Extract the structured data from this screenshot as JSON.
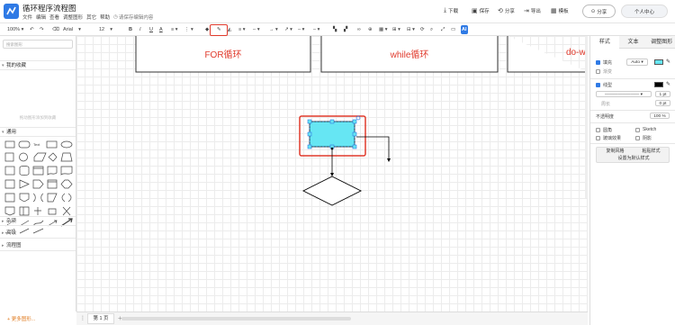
{
  "app": {
    "title": "循环程序流程图",
    "save_hint": "请保存编辑内容"
  },
  "menu": [
    "文件",
    "编辑",
    "查看",
    "调整图形",
    "其它",
    "帮助"
  ],
  "header_actions": [
    {
      "icon": "download-icon",
      "label": "下载"
    },
    {
      "icon": "save-icon",
      "label": "保存"
    },
    {
      "icon": "share-icon",
      "label": "分享"
    },
    {
      "icon": "export-icon",
      "label": "导出"
    },
    {
      "icon": "template-icon",
      "label": "模板"
    }
  ],
  "header_buttons": {
    "share": "分享",
    "user": "个人中心"
  },
  "toolbar": {
    "zoom": "100%",
    "font": "Arial",
    "font_size": "12",
    "bold": "B",
    "italic": "I",
    "underline": "U",
    "font_color": "A",
    "ai": "AI"
  },
  "left_panel": {
    "search_placeholder": "搜索图形",
    "sections": {
      "favorites": "我的收藏",
      "general": "通用",
      "misc": "杂项",
      "advanced": "高级",
      "flowchart": "流程图"
    },
    "favorites_hint": "拖动图形添加到收藏",
    "more_shapes": "+ 更多图形..."
  },
  "canvas": {
    "labels": [
      "FOR循环",
      "while循环",
      "do-w"
    ]
  },
  "bottom": {
    "page_tab": "第 1 页"
  },
  "right_panel": {
    "tabs": [
      "样式",
      "文本",
      "调整图形"
    ],
    "fill": {
      "label": "填充",
      "mode": "Auto",
      "color": "#66e6f3"
    },
    "gradient": "渐变",
    "line": {
      "label": "线型",
      "color": "#000000",
      "width": "1 pt"
    },
    "perimeter": {
      "label": "周长",
      "value": "0 pt"
    },
    "opacity": {
      "label": "不透明度",
      "value": "100 %"
    },
    "options": [
      {
        "label": "圆角",
        "checked": false
      },
      {
        "label": "Sketch",
        "checked": false
      },
      {
        "label": "玻璃效果",
        "checked": false
      },
      {
        "label": "阴影",
        "checked": false
      }
    ],
    "buttons": {
      "copy_style": "复制风格",
      "paste_style": "粘贴样式",
      "set_default": "设置为默认样式"
    }
  },
  "colors": {
    "accent": "#2f7ae5",
    "highlight": "#e03a2c",
    "canvas_text": "#e03a2c",
    "selected_fill": "#66e6f3"
  }
}
